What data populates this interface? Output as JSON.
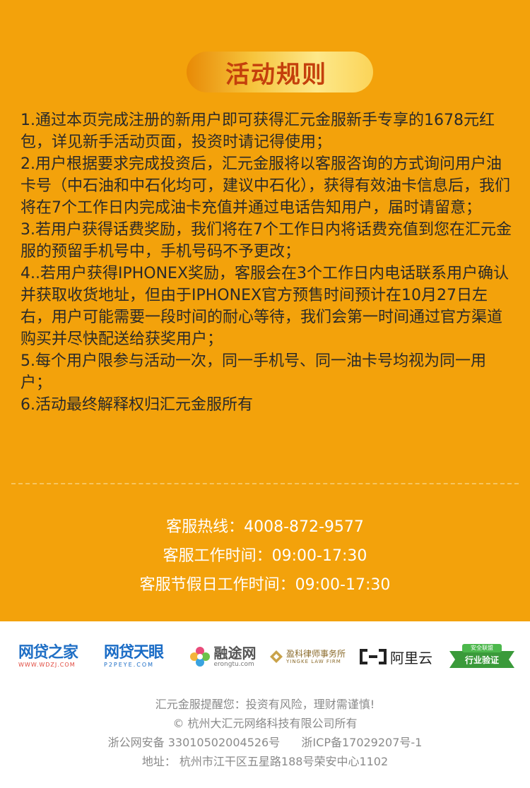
{
  "title": "活动规则",
  "rules": [
    "1.通过本页完成注册的新用户即可获得汇元金服新手专享的1678元红包，详见新手活动页面，投资时请记得使用；",
    "2.用户根据要求完成投资后，汇元金服将以客服咨询的方式询问用户油卡号（中石油和中石化均可，建议中石化），获得有效油卡信息后，我们将在7个工作日内完成油卡充值并通过电话告知用户，届时请留意；",
    "3.若用户获得话费奖励，我们将在7个工作日内将话费充值到您在汇元金服的预留手机号中，手机号码不予更改；",
    "4..若用户获得IPHONEX奖励，客服会在3个工作日内电话联系用户确认并获取收货地址，但由于IPHONEX官方预售时间预计在10月27日左右，用户可能需要一段时间的耐心等待，我们会第一时间通过官方渠道购买并尽快配送给获奖用户；",
    "5.每个用户限参与活动一次，同一手机号、同一油卡号均视为同一用户；",
    "6.活动最终解释权归汇元金服所有"
  ],
  "service": {
    "hotline_label": "客服热线：",
    "hotline": "4008-872-9577",
    "hours_label": "客服工作时间：",
    "hours": "09:00-17:30",
    "holiday_label": "客服节假日工作时间：",
    "holiday_hours": "09:00-17:30"
  },
  "partners": [
    {
      "name": "网贷之家",
      "sub": "WWW.WDZJ.COM",
      "icon": "wdzj-logo-icon"
    },
    {
      "name": "网贷天眼",
      "sub": "P2PEYE.COM",
      "icon": "p2peye-logo-icon"
    },
    {
      "name": "融途网",
      "sub": "erongtu.com",
      "icon": "erongtu-logo-icon"
    },
    {
      "name": "盈科律师事务所",
      "sub": "YINGKE LAW FIRM",
      "icon": "yingke-logo-icon"
    },
    {
      "name": "阿里云",
      "sub": "",
      "icon": "aliyun-logo-icon"
    },
    {
      "name": "安全联盟",
      "sub": "行业验证",
      "icon": "anquan-badge-icon"
    }
  ],
  "footer": {
    "reminder": "汇元金服提醒您：投资有风险，理财需谨慎!",
    "copyright": "© 杭州大汇元网络科技有限公司所有",
    "police": "浙公网安备 33010502004526号",
    "icp": "浙ICP备17029207号-1",
    "address": "地址： 杭州市江干区五星路188号荣安中心1102"
  },
  "colors": {
    "background": "#f3a20b",
    "title_text": "#c4400c",
    "body_text": "#2a2a2a",
    "service_text": "#ffffff",
    "footer_text": "#8a8a8a"
  }
}
